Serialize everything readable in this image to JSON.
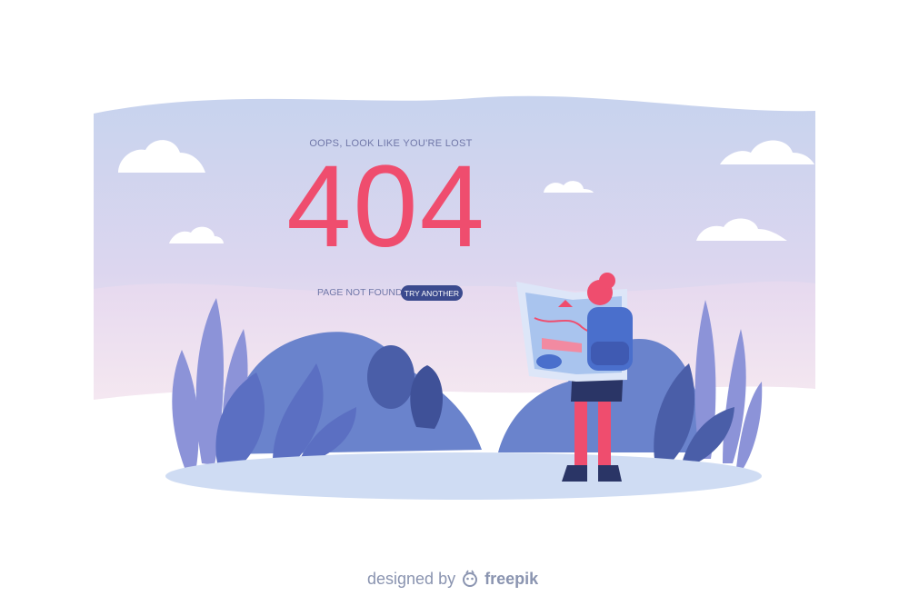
{
  "headline": {
    "oops": "OOPS, LOOK LIKE YOU'RE LOST",
    "code": "404",
    "not_found": "PAGE NOT FOUND",
    "try_button": "TRY ANOTHER"
  },
  "credit": {
    "designed_by": "designed by",
    "brand": "freepik"
  },
  "colors": {
    "accent": "#ef4d6e",
    "button": "#3b4a8e",
    "text_muted": "#7077a8",
    "sky_top": "#c7d3ee",
    "ground": "#cfdcf3",
    "foliage": "#6a83cc"
  }
}
